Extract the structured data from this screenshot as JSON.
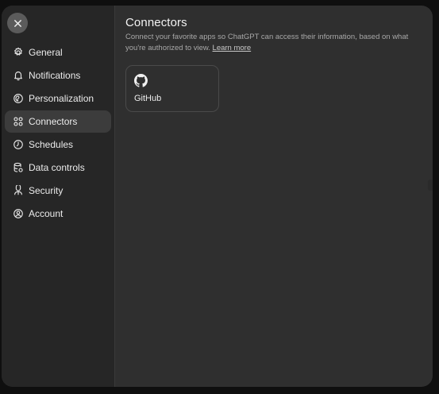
{
  "sidebar": {
    "items": [
      {
        "label": "General",
        "icon": "gear-icon"
      },
      {
        "label": "Notifications",
        "icon": "bell-icon"
      },
      {
        "label": "Personalization",
        "icon": "personalization-icon"
      },
      {
        "label": "Connectors",
        "icon": "connectors-icon",
        "active": true
      },
      {
        "label": "Schedules",
        "icon": "clock-icon"
      },
      {
        "label": "Data controls",
        "icon": "database-icon"
      },
      {
        "label": "Security",
        "icon": "shield-icon"
      },
      {
        "label": "Account",
        "icon": "user-icon"
      }
    ]
  },
  "main": {
    "title": "Connectors",
    "description": "Connect your favorite apps so ChatGPT can access their information, based on what you're authorized to view.",
    "learn_more": "Learn more",
    "cards": [
      {
        "label": "GitHub",
        "icon": "github-icon"
      }
    ]
  },
  "colors": {
    "background": "#0f0f0f",
    "modal": "#2f2f2f",
    "sidebar": "#262626",
    "active_item": "#3c3c3c",
    "text": "#ececec",
    "muted_text": "#a8a8a8"
  }
}
